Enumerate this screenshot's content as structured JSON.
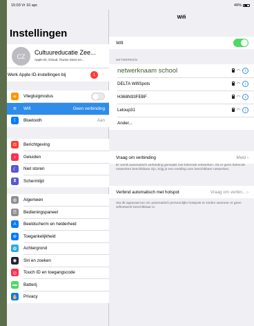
{
  "status_bar": {
    "time": "15:03 Vr 16 apr.",
    "battery": "49%"
  },
  "left": {
    "title": "Instellingen",
    "profile": {
      "initials": "CZ",
      "name": "Cultuureducatie Zee...",
      "subtitle": "Apple ID, iCloud, iTunes Store en..."
    },
    "apple_id_row": {
      "label": "Werk Apple ID-instellingen bij",
      "badge": "1"
    },
    "group1": [
      {
        "label": "Vliegtuigmodus",
        "icon": "airplane-icon",
        "color": "#ff9500",
        "glyph": "✈",
        "value": ""
      },
      {
        "label": "Wifi",
        "icon": "wifi-icon",
        "color": "#2f8ce8",
        "glyph": "≋",
        "value": "Geen verbinding",
        "selected": true
      },
      {
        "label": "Bluetooth",
        "icon": "bluetooth-icon",
        "color": "#007aff",
        "glyph": "ᛒ",
        "value": "Aan"
      }
    ],
    "group2": [
      {
        "label": "Berichtgeving",
        "icon": "notifications-icon",
        "color": "#ff3b30",
        "glyph": "◘"
      },
      {
        "label": "Geluiden",
        "icon": "sounds-icon",
        "color": "#ff2d55",
        "glyph": "♪"
      },
      {
        "label": "Niet storen",
        "icon": "moon-icon",
        "color": "#5856d6",
        "glyph": "☾"
      },
      {
        "label": "Schermtijd",
        "icon": "hourglass-icon",
        "color": "#5856d6",
        "glyph": "⧗"
      }
    ],
    "group3": [
      {
        "label": "Algemeen",
        "icon": "gear-icon",
        "color": "#8e8e93",
        "glyph": "⚙"
      },
      {
        "label": "Bedieningspaneel",
        "icon": "control-center-icon",
        "color": "#8e8e93",
        "glyph": "☰"
      },
      {
        "label": "Beeldscherm en helderheid",
        "icon": "display-icon",
        "color": "#007aff",
        "glyph": "A"
      },
      {
        "label": "Toegankelijkheid",
        "icon": "accessibility-icon",
        "color": "#007aff",
        "glyph": "⊛"
      },
      {
        "label": "Achtergrond",
        "icon": "wallpaper-icon",
        "color": "#34aadc",
        "glyph": "✿"
      },
      {
        "label": "Siri en zoeken",
        "icon": "siri-icon",
        "color": "#222233",
        "glyph": "◉"
      },
      {
        "label": "Touch ID en toegangscode",
        "icon": "fingerprint-icon",
        "color": "#ff2d55",
        "glyph": "◎"
      },
      {
        "label": "Batterij",
        "icon": "battery-icon",
        "color": "#4cd964",
        "glyph": "▬"
      },
      {
        "label": "Privacy",
        "icon": "hand-icon",
        "color": "#007aff",
        "glyph": "✋"
      }
    ]
  },
  "right": {
    "title": "Wifi",
    "wifi_label": "Wifi",
    "wifi_on": true,
    "networks_header": "NETWERKEN",
    "networks": [
      {
        "name": "netwerknaam school",
        "connected": true
      },
      {
        "name": "DELTA WifiSpots"
      },
      {
        "name": "H368N93FEBF"
      },
      {
        "name": "Leloup31"
      }
    ],
    "other": "Ander...",
    "ask_join": {
      "label": "Vraag om verbinding",
      "value": "Meld"
    },
    "ask_join_note": "Er wordt automatisch verbinding gemaakt met bekende netwerken. Als er geen bekende netwerken beschikbaar zijn, krijg je een melding over beschikbare netwerken.",
    "hotspot": {
      "label": "Verbind automatisch met hotspot",
      "value": "Vraag om verbin..."
    },
    "hotspot_note": "Sta dit apparaat toe om automatisch persoonlijke hotspots te vinden wanneer er geen wifinetwerk beschikbaar is."
  }
}
